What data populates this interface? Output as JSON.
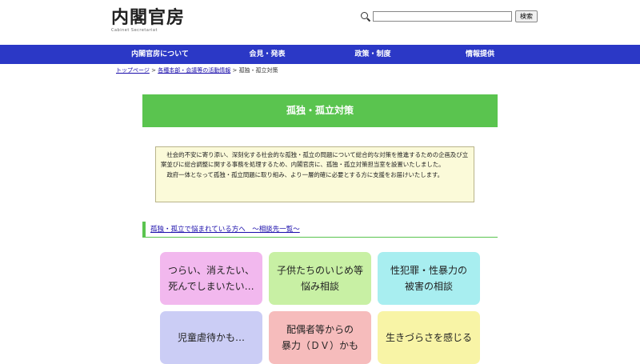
{
  "header": {
    "logo_main": "内閣官房",
    "logo_sub": "Cabinet Secretariat",
    "search": {
      "placeholder": "",
      "value": "",
      "button_label": "検索"
    }
  },
  "nav": {
    "items": [
      {
        "label": "内閣官房について"
      },
      {
        "label": "会見・発表"
      },
      {
        "label": "政策・制度"
      },
      {
        "label": "情報提供"
      }
    ]
  },
  "breadcrumb": {
    "items": [
      {
        "label": "トップページ"
      },
      {
        "label": "各種本部・会議等の活動情報"
      },
      {
        "label": "孤独・孤立対策"
      }
    ],
    "separator": ">"
  },
  "page": {
    "title": "孤独・孤立対策",
    "intro": [
      "社会的不安に寄り添い、深刻化する社会的な孤独・孤立の問題について総合的な対策を推進するための企画及び立案並びに総合調整に関する事務を処理するため、内閣官房に、孤独・孤立対策担当室を設置いたしました。",
      "政府一体となって孤独・孤立問題に取り組み、より一層的確に必要とする方に支援をお届けいたします。"
    ],
    "section_link": "孤独・孤立で悩まれている方へ　～相談先一覧～"
  },
  "cards": [
    {
      "label": "つらい、消えたい、\n死んでしまいたい…",
      "color": "#f2b8ee"
    },
    {
      "label": "子供たちのいじめ等\n悩み相談",
      "color": "#c8f0a4"
    },
    {
      "label": "性犯罪・性暴力の\n被害の相談",
      "color": "#a8eef0"
    },
    {
      "label": "児童虐待かも…",
      "color": "#cbcdf5"
    },
    {
      "label": "配偶者等からの\n暴力（ＤＶ）かも",
      "color": "#f6bcbc"
    },
    {
      "label": "生きづらさを感じる",
      "color": "#f8f4a6"
    }
  ],
  "colors": {
    "nav_bg": "#2b38c6",
    "title_bg": "#5ac44f",
    "intro_bg": "#fbfad9",
    "link": "#1a0dab"
  }
}
